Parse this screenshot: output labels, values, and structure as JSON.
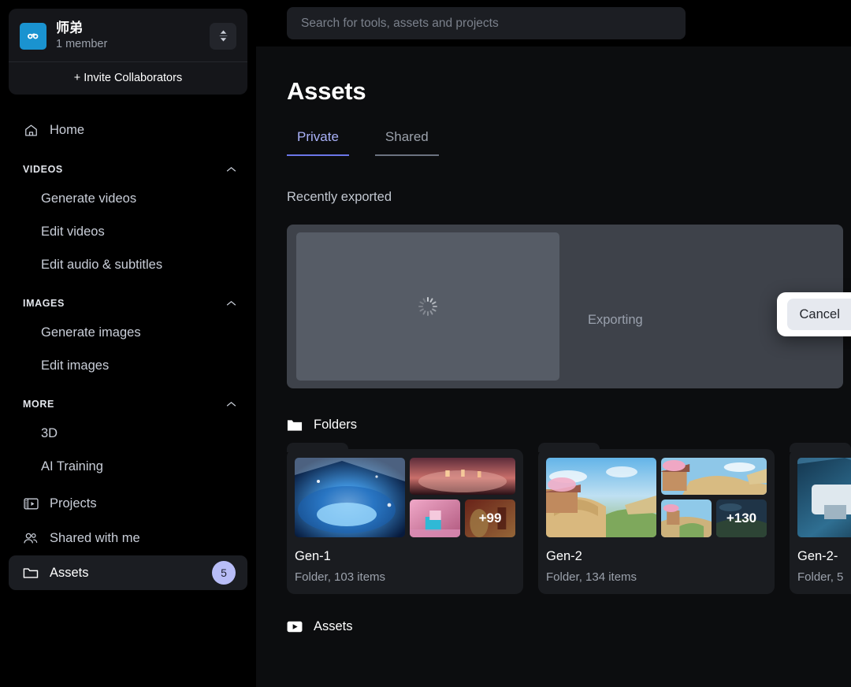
{
  "sidebar": {
    "workspace": {
      "name": "师弟",
      "members": "1 member",
      "invite_label": "+ Invite Collaborators"
    },
    "home": {
      "label": "Home",
      "icon": "home-icon"
    },
    "sections": [
      {
        "title": "VIDEOS",
        "items": [
          {
            "label": "Generate videos"
          },
          {
            "label": "Edit videos"
          },
          {
            "label": "Edit audio & subtitles"
          }
        ]
      },
      {
        "title": "IMAGES",
        "items": [
          {
            "label": "Generate images"
          },
          {
            "label": "Edit images"
          }
        ]
      },
      {
        "title": "MORE",
        "items": [
          {
            "label": "3D"
          },
          {
            "label": "AI Training"
          }
        ]
      }
    ],
    "bottom_items": [
      {
        "label": "Projects",
        "icon": "projects-icon"
      },
      {
        "label": "Shared with me",
        "icon": "people-icon"
      },
      {
        "label": "Assets",
        "icon": "folder-icon",
        "badge": "5",
        "active": true
      }
    ]
  },
  "topbar": {
    "search_placeholder": "Search for tools, assets and projects",
    "search_value": ""
  },
  "main": {
    "title": "Assets",
    "tabs": [
      {
        "label": "Private",
        "active": true
      },
      {
        "label": "Shared",
        "active": false
      }
    ],
    "recently_exported": {
      "label": "Recently exported",
      "status": "Exporting"
    },
    "folders_section": {
      "label": "Folders",
      "cards": [
        {
          "name": "Gen-1",
          "meta": "Folder, 103 items",
          "more_count": "+99"
        },
        {
          "name": "Gen-2",
          "meta": "Folder, 134 items",
          "more_count": "+130"
        },
        {
          "name": "Gen-2-",
          "meta": "Folder, 5",
          "more_count": ""
        }
      ]
    },
    "assets_section": {
      "label": "Assets"
    }
  },
  "modal": {
    "cancel_label": "Cancel"
  },
  "colors": {
    "accent": "#6b76e8",
    "tab_active_text": "#a9b1f8",
    "badge_bg": "#b8bdf7",
    "avatar_bg": "#1a93d0",
    "page_bg": "#0c0d0f",
    "sidebar_bg": "#000000"
  }
}
